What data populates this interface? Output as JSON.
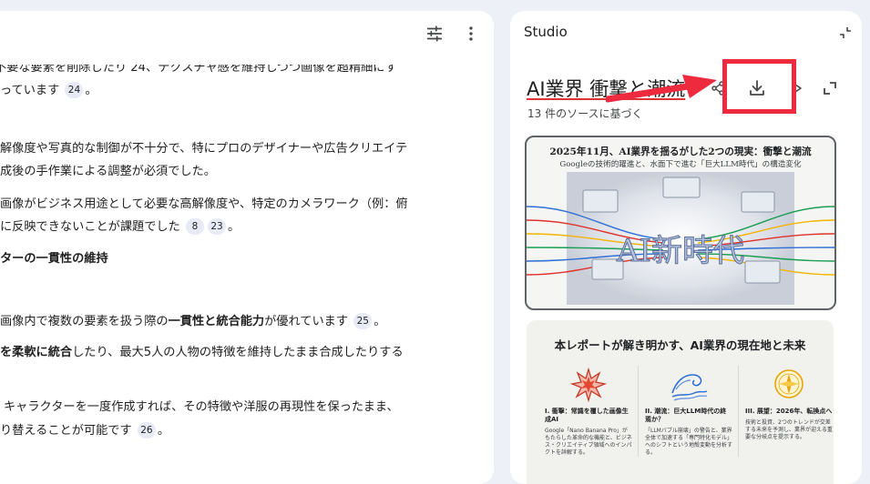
{
  "chat": {
    "lines": {
      "l0": "不要な要素を削除したり 24、テクスチャ感を維持しつつ画像を超精細にす",
      "l1a": "っています",
      "l2": "解像度や写真的な制御が不十分で、特にプロのデザイナーや広告クリエイテ",
      "l3": "成後の手作業による調整が必須でした。",
      "l4": "画像がビジネス用途として必要な高解像度や、特定のカメラワーク（例：俯",
      "l5": "に反映できないことが課題でした",
      "l6": "ターの一貫性の維持",
      "l7a": "画像内で複数の要素を扱う際の",
      "l7b": "一貫性と統合能力",
      "l7c": "が優れています",
      "l8a": "を柔軟に統合",
      "l8b": "したり、最大5人の人物の特徴を維持したまま合成したりする",
      "l9": "キャラクターを一度作成すれば、その特徴や洋服の再現性を保ったまま、",
      "l10": "り替えることが可能です"
    },
    "citations": {
      "c1": "24",
      "c2": "8",
      "c3": "23",
      "c4": "25",
      "c5": "26"
    },
    "toolbar": {
      "tune_icon": "tune-icon",
      "more_icon": "more-vert-icon"
    }
  },
  "studio": {
    "title": "Studio",
    "report_title": "AI業界 衝撃と潮流",
    "report_subtitle": "13 件のソースに基づく",
    "slide1": {
      "title": "2025年11月、AI業界を揺るがした2つの現実：衝撃と潮流",
      "subtitle": "Googleの技術的躍進と、水面下で進む「巨大LLM時代」の構造変化",
      "art_text": "AI新時代"
    },
    "slide2": {
      "title": "本レポートが解き明かす、AI業界の現在地と未来",
      "columns": [
        {
          "head": "I. 衝撃：常識を覆した画像生成AI",
          "text": "Google「Nano Banana Pro」がもたらした革命的な機能と、ビジネス・クリエイティブ領域へのインパクトを詳解する。"
        },
        {
          "head": "II. 潮流：巨大LLM時代の終焉か？",
          "text": "「LLMバブル崩壊」の警告と、業界全体で加速する「専門特化モデル」へのシフトという地殻変動を分析する。"
        },
        {
          "head": "III. 展望：2026年、転換点へ",
          "text": "技術と投資、2つのトレンドが交差する未来を予測し、業界が迎える重要な分岐点を提示する。"
        }
      ]
    }
  },
  "colors": {
    "highlight": "#ee2a3e",
    "citation_bg": "#e8eaf6",
    "page_bg": "#eef0f8"
  }
}
